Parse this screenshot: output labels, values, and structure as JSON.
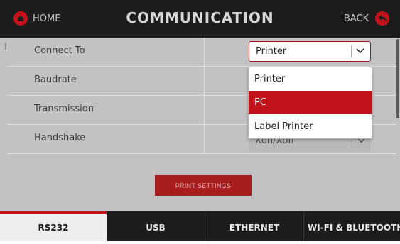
{
  "header": {
    "home_label": "HOME",
    "title": "COMMUNICATION",
    "back_label": "BACK"
  },
  "settings": {
    "rows": [
      {
        "label": "Connect To"
      },
      {
        "label": "Baudrate"
      },
      {
        "label": "Transmission"
      },
      {
        "label": "Handshake"
      }
    ],
    "connect_to_value": "Printer",
    "handshake_value": "Xon/Xoff",
    "dropdown_options": [
      {
        "label": "Printer",
        "selected": false
      },
      {
        "label": "PC",
        "selected": true
      },
      {
        "label": "Label Printer",
        "selected": false
      }
    ]
  },
  "print_settings_label": "PRINT SETTINGS",
  "tabs": [
    {
      "label": "RS232",
      "active": true
    },
    {
      "label": "USB",
      "active": false
    },
    {
      "label": "ETHERNET",
      "active": false
    },
    {
      "label": "WI-FI & BLUETOOTH",
      "active": false
    }
  ],
  "colors": {
    "accent": "#c2121a",
    "header_bg": "#1c1c1c",
    "content_bg": "#c2c2c2"
  },
  "icons": {
    "home": "home-icon",
    "back": "back-arrow-icon",
    "select": "chevron-down-icon"
  }
}
